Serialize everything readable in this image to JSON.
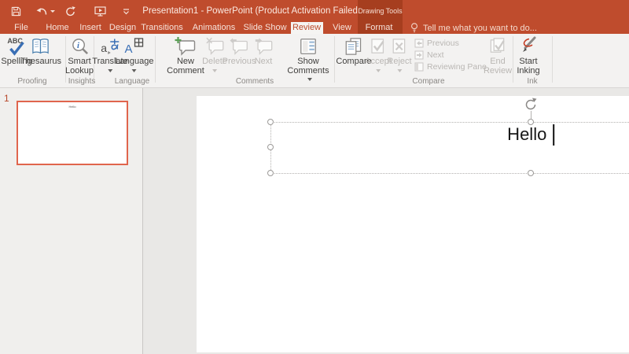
{
  "titlebar": {
    "title": "Presentation1 - PowerPoint (Product Activation Failed)",
    "contextual_group": "Drawing Tools",
    "search_placeholder": "Tell me what you want to do..."
  },
  "tabs": {
    "file": "File",
    "home": "Home",
    "insert": "Insert",
    "design": "Design",
    "transitions": "Transitions",
    "animations": "Animations",
    "slide_show": "Slide Show",
    "review": "Review",
    "view": "View",
    "format": "Format"
  },
  "ribbon": {
    "proofing": {
      "label": "Proofing",
      "spelling": "Spelling",
      "thesaurus": "Thesaurus"
    },
    "insights": {
      "label": "Insights",
      "smart_lookup": "Smart Lookup"
    },
    "language_group": {
      "label": "Language",
      "translate": "Translate",
      "language": "Language"
    },
    "comments": {
      "label": "Comments",
      "new_comment": "New Comment",
      "delete": "Delete",
      "previous": "Previous",
      "next": "Next",
      "show_comments": "Show Comments"
    },
    "compare": {
      "label": "Compare",
      "compare": "Compare",
      "accept": "Accept",
      "reject": "Reject",
      "previous": "Previous",
      "next": "Next",
      "reviewing_pane": "Reviewing Pane",
      "end_review": "End Review"
    },
    "ink": {
      "label": "Ink",
      "start_inking": "Start Inking"
    }
  },
  "slides_panel": {
    "slide_number": "1",
    "thumbnail_text": "Hello"
  },
  "slide": {
    "textbox_text": "Hello"
  },
  "icons": {
    "qat": [
      "save-icon",
      "undo-icon",
      "redo-icon",
      "start-from-beginning-icon",
      "customize-quick-access-icon"
    ],
    "search": "lightbulb-icon",
    "ribbon": [
      "spelling-icon",
      "thesaurus-icon",
      "smart-lookup-icon",
      "translate-icon",
      "language-icon",
      "new-comment-icon",
      "delete-comment-icon",
      "previous-comment-icon",
      "next-comment-icon",
      "show-comments-icon",
      "compare-icon",
      "accept-icon",
      "reject-icon",
      "end-review-icon",
      "start-inking-icon"
    ],
    "textbox": "rotate-handle-icon"
  },
  "colors": {
    "titlebar_red": "#bf4c2d",
    "contextual_red": "#a63e1f",
    "active_tab_text": "#bc4b2b",
    "ribbon_bg": "#f3f2f1",
    "thumbnail_border": "#e0654d",
    "slide_number_red": "#b7472a"
  }
}
